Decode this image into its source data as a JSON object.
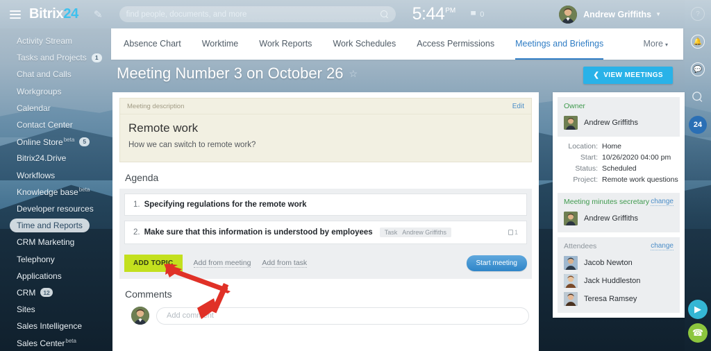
{
  "topbar": {
    "logo_text": "Bitrix",
    "logo_num": "24",
    "search_placeholder": "find people, documents, and more",
    "clock_time": "5:44",
    "clock_ampm": "PM",
    "flag_count": "0",
    "user_name": "Andrew Griffiths"
  },
  "nav": {
    "tabs": [
      {
        "label": "Absence Chart",
        "active": false
      },
      {
        "label": "Worktime",
        "active": false
      },
      {
        "label": "Work Reports",
        "active": false
      },
      {
        "label": "Work Schedules",
        "active": false
      },
      {
        "label": "Access Permissions",
        "active": false
      },
      {
        "label": "Meetings and Briefings",
        "active": true
      }
    ],
    "more_label": "More"
  },
  "sidebar": {
    "items": [
      {
        "label": "Activity Stream",
        "badge": "",
        "beta": false,
        "active": false
      },
      {
        "label": "Tasks and Projects",
        "badge": "1",
        "beta": false,
        "active": false
      },
      {
        "label": "Chat and Calls",
        "badge": "",
        "beta": false,
        "active": false
      },
      {
        "label": "Workgroups",
        "badge": "",
        "beta": false,
        "active": false
      },
      {
        "label": "Calendar",
        "badge": "",
        "beta": false,
        "active": false
      },
      {
        "label": "Contact Center",
        "badge": "",
        "beta": false,
        "active": false
      },
      {
        "label": "Online Store",
        "badge": "5",
        "beta": true,
        "active": false
      },
      {
        "label": "Bitrix24.Drive",
        "badge": "",
        "beta": false,
        "active": false
      },
      {
        "label": "Workflows",
        "badge": "",
        "beta": false,
        "active": false
      },
      {
        "label": "Knowledge base",
        "badge": "",
        "beta": true,
        "active": false
      },
      {
        "label": "Developer resources",
        "badge": "",
        "beta": false,
        "active": false
      },
      {
        "label": "Time and Reports",
        "badge": "",
        "beta": false,
        "active": true
      },
      {
        "label": "CRM Marketing",
        "badge": "",
        "beta": false,
        "active": false
      },
      {
        "label": "Telephony",
        "badge": "",
        "beta": false,
        "active": false
      },
      {
        "label": "Applications",
        "badge": "",
        "beta": false,
        "active": false
      },
      {
        "label": "CRM",
        "badge": "12",
        "beta": false,
        "active": false
      },
      {
        "label": "Sites",
        "badge": "",
        "beta": false,
        "active": false
      },
      {
        "label": "Sales Intelligence",
        "badge": "",
        "beta": false,
        "active": false
      },
      {
        "label": "Sales Center",
        "badge": "",
        "beta": true,
        "active": false
      }
    ],
    "beta_label": "beta"
  },
  "page": {
    "title": "Meeting Number 3 on October 26",
    "view_meetings_label": "VIEW MEETINGS"
  },
  "description": {
    "section_label": "Meeting description",
    "edit_label": "Edit",
    "heading": "Remote work",
    "body": "How we can switch to remote work?"
  },
  "agenda": {
    "title": "Agenda",
    "items": [
      {
        "num": "1.",
        "text": "Specifying regulations for the remote work",
        "tag_key": "",
        "tag_value": "",
        "count": ""
      },
      {
        "num": "2.",
        "text": "Make sure that this information is understood by employees",
        "tag_key": "Task",
        "tag_value": "Andrew Griffiths",
        "count": "1"
      }
    ],
    "add_topic_label": "ADD TOPIC",
    "add_from_meeting_label": "Add from meeting",
    "add_from_task_label": "Add from task",
    "start_meeting_label": "Start meeting"
  },
  "comments": {
    "title": "Comments",
    "placeholder": "Add comment"
  },
  "rightpanel": {
    "owner_label": "Owner",
    "owner_name": "Andrew Griffiths",
    "fields": [
      {
        "key": "Location:",
        "value": "Home"
      },
      {
        "key": "Start:",
        "value": "10/26/2020 04:00 pm"
      },
      {
        "key": "Status:",
        "value": "Scheduled"
      },
      {
        "key": "Project:",
        "value": "Remote work questions"
      }
    ],
    "secretary_label": "Meeting minutes secretary",
    "secretary_change_label": "change",
    "secretary_name": "Andrew Griffiths",
    "attendees_label": "Attendees",
    "attendees_change_label": "change",
    "attendees": [
      {
        "name": "Jacob Newton"
      },
      {
        "name": "Jack Huddleston"
      },
      {
        "name": "Teresa Ramsey"
      }
    ]
  },
  "rightrail": {
    "help_icon": "?",
    "badge_label": "24"
  },
  "colors": {
    "accent_blue": "#2e7cc4",
    "add_topic_green": "#c3e01e",
    "view_meetings_blue": "#29b2e8",
    "arrow_red": "#e03127"
  }
}
